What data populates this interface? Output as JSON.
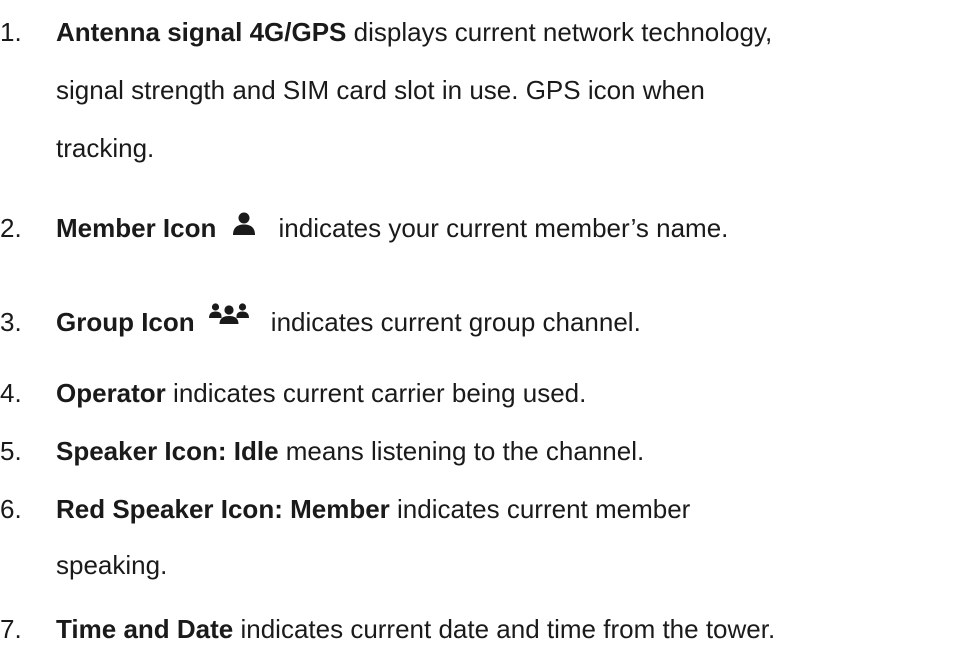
{
  "items": [
    {
      "number": "1.",
      "term": "Antenna signal 4G/GPS",
      "text_line1": " displays current network technology,",
      "text_line2": "signal strength and SIM card slot in use. GPS icon when",
      "text_line3": "tracking."
    },
    {
      "number": "2.",
      "term": "Member Icon",
      "icon": "person-icon",
      "text_line1": " indicates your current member’s name."
    },
    {
      "number": "3.",
      "term": "Group Icon",
      "icon": "group-icon",
      "text_line1": " indicates current group channel."
    },
    {
      "number": "4.",
      "term": "Operator",
      "text_line1": " indicates current carrier being used."
    },
    {
      "number": "5.",
      "term": "Speaker Icon: Idle",
      "text_line1": " means listening to the channel."
    },
    {
      "number": "6.",
      "term": "Red Speaker Icon: Member",
      "text_line1": " indicates current member",
      "text_line2": "speaking."
    },
    {
      "number": "7.",
      "term": "Time and Date",
      "text_line1": " indicates current date and time from the tower."
    }
  ]
}
